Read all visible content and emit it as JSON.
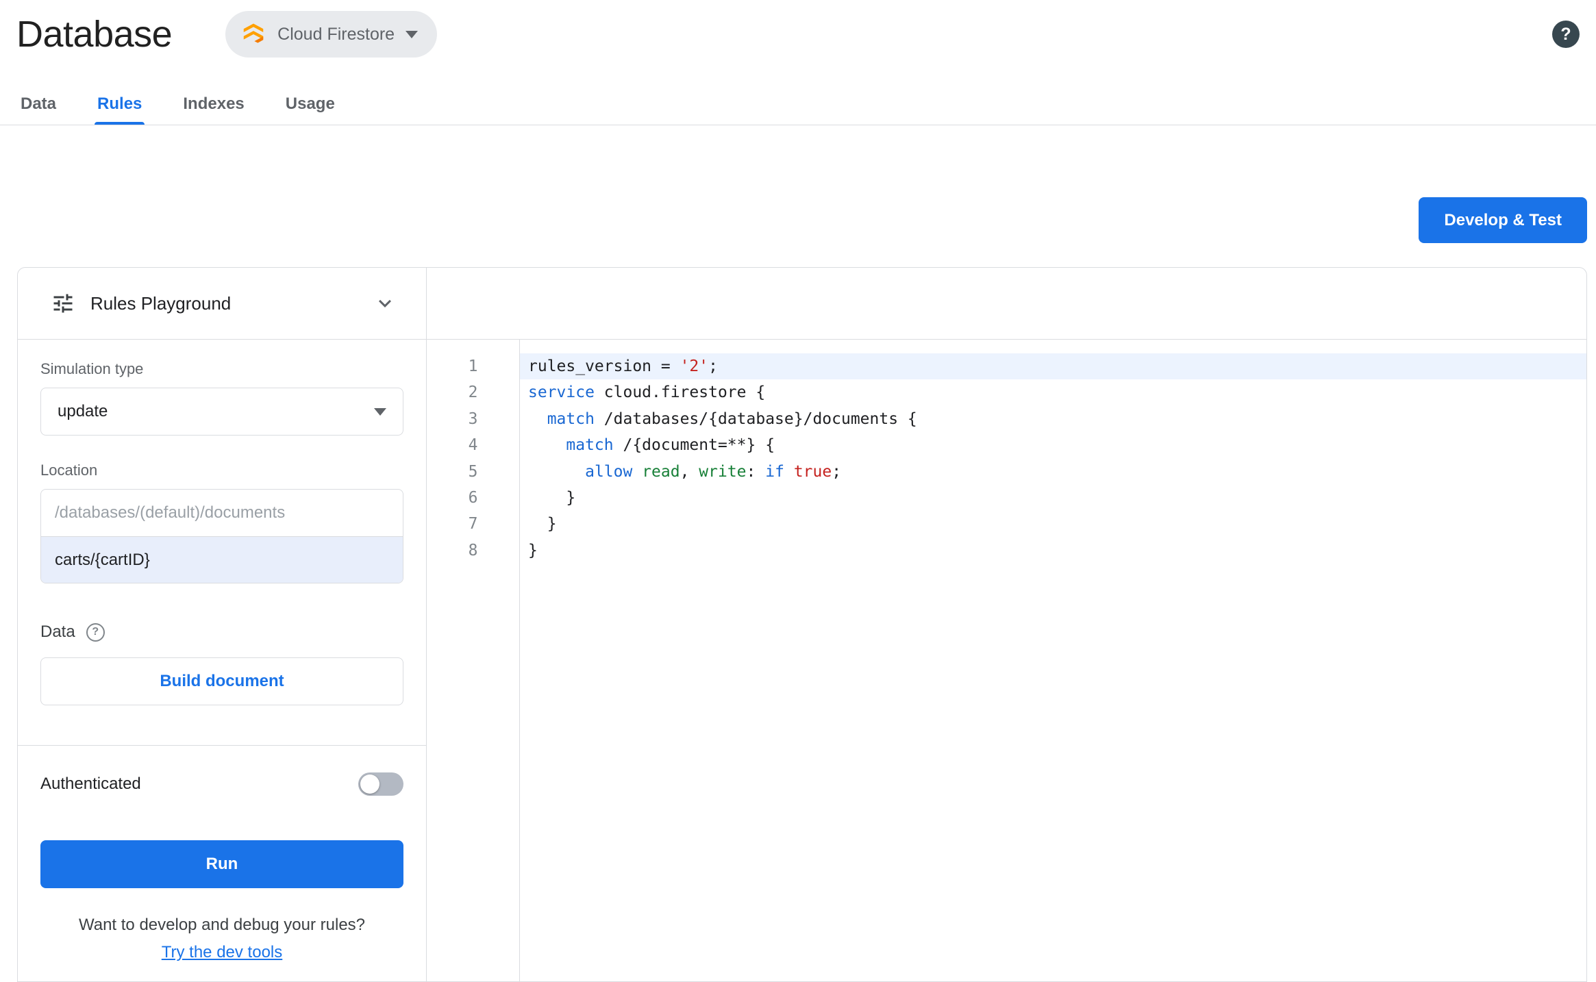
{
  "colors": {
    "accent": "#1a73e8",
    "code_keyword": "#1967d2",
    "code_string": "#c5221f",
    "code_property": "#188038",
    "code_literal": "#c5221f",
    "code_plain": "#202124",
    "active_line_bg": "#ecf3fe",
    "firestore_amber": "#FFA000",
    "firestore_amber_dark": "#F57C00"
  },
  "header": {
    "title": "Database",
    "product_selector": {
      "label": "Cloud Firestore"
    },
    "help_glyph": "?"
  },
  "tabs": [
    {
      "label": "Data",
      "active": false
    },
    {
      "label": "Rules",
      "active": true
    },
    {
      "label": "Indexes",
      "active": false
    },
    {
      "label": "Usage",
      "active": false
    }
  ],
  "toolbar": {
    "develop_test_label": "Develop & Test"
  },
  "playground": {
    "title": "Rules Playground",
    "simulation_type_label": "Simulation type",
    "simulation_type_value": "update",
    "location_label": "Location",
    "location_placeholder": "/databases/(default)/documents",
    "location_value": "carts/{cartID}",
    "data_label": "Data",
    "help_glyph": "?",
    "build_document_label": "Build document",
    "authenticated_label": "Authenticated",
    "authenticated_enabled": false,
    "run_label": "Run",
    "footer_question": "Want to develop and debug your rules?",
    "footer_link": "Try the dev tools"
  },
  "editor": {
    "active_line": 1,
    "lines": [
      {
        "number": 1,
        "tokens": [
          {
            "c": "p",
            "t": "rules_version = "
          },
          {
            "c": "s",
            "t": "'2'"
          },
          {
            "c": "p",
            "t": ";"
          }
        ]
      },
      {
        "number": 2,
        "tokens": [
          {
            "c": "k",
            "t": "service"
          },
          {
            "c": "p",
            "t": " cloud.firestore {"
          }
        ]
      },
      {
        "number": 3,
        "tokens": [
          {
            "c": "p",
            "t": "  "
          },
          {
            "c": "k",
            "t": "match"
          },
          {
            "c": "p",
            "t": " /databases/{database}/documents {"
          }
        ]
      },
      {
        "number": 4,
        "tokens": [
          {
            "c": "p",
            "t": "    "
          },
          {
            "c": "k",
            "t": "match"
          },
          {
            "c": "p",
            "t": " /{document=**} {"
          }
        ]
      },
      {
        "number": 5,
        "tokens": [
          {
            "c": "p",
            "t": "      "
          },
          {
            "c": "k",
            "t": "allow"
          },
          {
            "c": "p",
            "t": " "
          },
          {
            "c": "g",
            "t": "read"
          },
          {
            "c": "p",
            "t": ", "
          },
          {
            "c": "g",
            "t": "write"
          },
          {
            "c": "p",
            "t": ": "
          },
          {
            "c": "k",
            "t": "if"
          },
          {
            "c": "p",
            "t": " "
          },
          {
            "c": "r",
            "t": "true"
          },
          {
            "c": "p",
            "t": ";"
          }
        ]
      },
      {
        "number": 6,
        "tokens": [
          {
            "c": "p",
            "t": "    }"
          }
        ]
      },
      {
        "number": 7,
        "tokens": [
          {
            "c": "p",
            "t": "  }"
          }
        ]
      },
      {
        "number": 8,
        "tokens": [
          {
            "c": "p",
            "t": "}"
          }
        ]
      }
    ]
  }
}
